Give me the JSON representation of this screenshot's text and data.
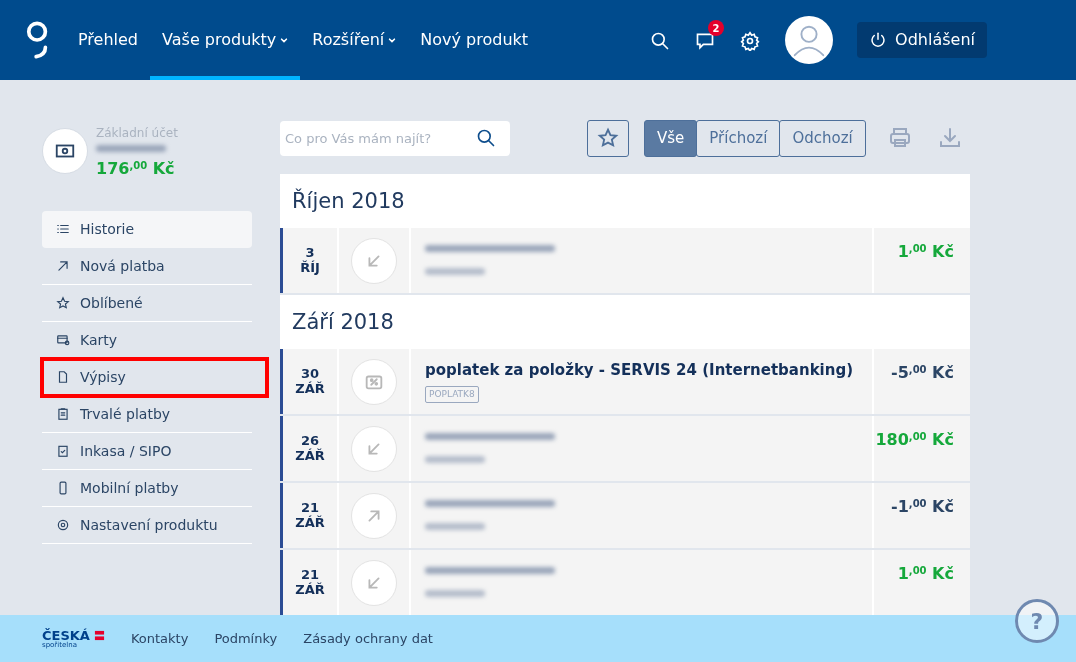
{
  "nav": {
    "items": [
      {
        "label": "Přehled",
        "dropdown": false,
        "selected": false
      },
      {
        "label": "Vaše produkty",
        "dropdown": true,
        "selected": true
      },
      {
        "label": "Rozšíření",
        "dropdown": true,
        "selected": false
      },
      {
        "label": "Nový produkt",
        "dropdown": false,
        "selected": false
      }
    ],
    "messages_badge": "2",
    "logout": "Odhlášení"
  },
  "account": {
    "name": "Základní účet",
    "number_redacted": true,
    "balance": "176$^{,00}$ Kč"
  },
  "sidebar": {
    "items": [
      {
        "label": "Historie",
        "selected": true,
        "highlighted": false
      },
      {
        "label": "Nová platba",
        "selected": false,
        "highlighted": false
      },
      {
        "label": "Oblíbené",
        "selected": false,
        "highlighted": false
      },
      {
        "label": "Karty",
        "selected": false,
        "highlighted": false
      },
      {
        "label": "Výpisy",
        "selected": false,
        "highlighted": true
      },
      {
        "label": "Trvalé platby",
        "selected": false,
        "highlighted": false
      },
      {
        "label": "Inkasa / SIPO",
        "selected": false,
        "highlighted": false
      },
      {
        "label": "Mobilní platby",
        "selected": false,
        "highlighted": false
      },
      {
        "label": "Nastavení produktu",
        "selected": false,
        "highlighted": false
      }
    ]
  },
  "toolbar": {
    "search": {
      "placeholder": "Co pro Vás mám najít?"
    },
    "filters": [
      {
        "label": "Vše",
        "selected": true
      },
      {
        "label": "Příchozí",
        "selected": false
      },
      {
        "label": "Odchozí",
        "selected": false
      }
    ]
  },
  "months": [
    {
      "title": "Říjen 2018",
      "transactions": [
        {
          "day": "3",
          "month": "ŘÍJ",
          "kind": "incoming",
          "redacted": true,
          "amount": "1$^{,00}$ Kč"
        }
      ]
    },
    {
      "title": "Září 2018",
      "transactions": [
        {
          "day": "30",
          "month": "ZÁŘ",
          "kind": "fee",
          "redacted": false,
          "title": "poplatek za položky - SERVIS 24 (Internetbanking)",
          "tag": "POPLATK8",
          "amount": "-5$^{,00}$ Kč"
        },
        {
          "day": "26",
          "month": "ZÁŘ",
          "kind": "incoming",
          "redacted": true,
          "amount": "180$^{,00}$ Kč"
        },
        {
          "day": "21",
          "month": "ZÁŘ",
          "kind": "outgoing",
          "redacted": true,
          "amount": "-1$^{,00}$ Kč"
        },
        {
          "day": "21",
          "month": "ZÁŘ",
          "kind": "incoming",
          "redacted": true,
          "amount": "1$^{,00}$ Kč"
        }
      ]
    }
  ],
  "footer": {
    "brand_top": "ČESKÁ",
    "brand_bottom": "spořitelna",
    "links": [
      "Kontakty",
      "Podmínky",
      "Zásady ochrany dat"
    ]
  },
  "help": "?"
}
